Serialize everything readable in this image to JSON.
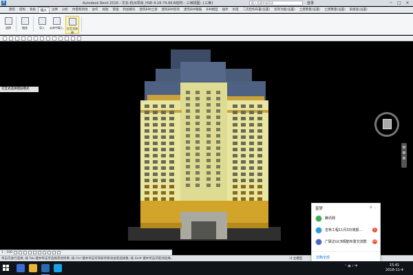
{
  "titlebar": {
    "app_icon": "R",
    "title": "Autodesk Revit 2016 -   华东-杭州项目_HSE-4-16-74.86-B结构 - 三维视图: {三维}",
    "search_placeholder": "键入关键字或短语",
    "user": "登录",
    "minimize": "─",
    "maximize": "□",
    "close": "✕"
  },
  "ribbon_tabs": [
    "建筑",
    "结构",
    "系统",
    "插入",
    "注释",
    "分析",
    "体量和场地",
    "协作",
    "视图",
    "管理",
    "附加模块",
    "建筑BIM土建",
    "建筑BIM装饰",
    "建筑BIM钢筋",
    "BIM模型",
    "插件",
    "机电",
    "二次结构布置(设置)",
    "装饰功能(设置)",
    "土建算量(设置)",
    "土建算量(设置)",
    "链接族(设置)"
  ],
  "active_tab_index": 3,
  "ribbon": {
    "buttons": [
      {
        "label": "选择"
      },
      {
        "label": "链接"
      },
      {
        "label": "导入"
      },
      {
        "label": "从库中载入"
      },
      {
        "label": "交互式选择"
      }
    ],
    "groups": [
      "选择",
      "链接",
      "导入",
      "从库中载入"
    ]
  },
  "view_tab": "交互式选择图层模式",
  "view_controls": {
    "scale": "1 : 100"
  },
  "status": {
    "left": "单击可进行选择; 按 Tab 键并单击可选择其他项目; 按 Ctrl 键并单击可将新项目添加到选择集; 按 Shift 键并单击可取消选择。",
    "right": ":0  主模型"
  },
  "qq": {
    "title": "蓝梦",
    "controls": "⚙ ⌄",
    "items": [
      {
        "name": "腾讯网",
        "badge": "",
        "avatar_color": "#2db34a"
      },
      {
        "name": "吉林工程11月3日简报...",
        "badge": "1",
        "avatar_color": "#1e9ee6"
      },
      {
        "name": "广联达GCB钢筋布置交流群",
        "badge": "25",
        "avatar_color": "#4466cc"
      }
    ],
    "footer": "忽略全部"
  },
  "taskbar": {
    "tray": "⌃  ▣  ♪  中",
    "time": "15:41",
    "date": "2018-11-4"
  },
  "colors": {
    "building_facade": "#e8e6a0",
    "building_base": "#d2a52a",
    "building_roof": "#4a5c78",
    "viewport_bg": "#000000"
  }
}
